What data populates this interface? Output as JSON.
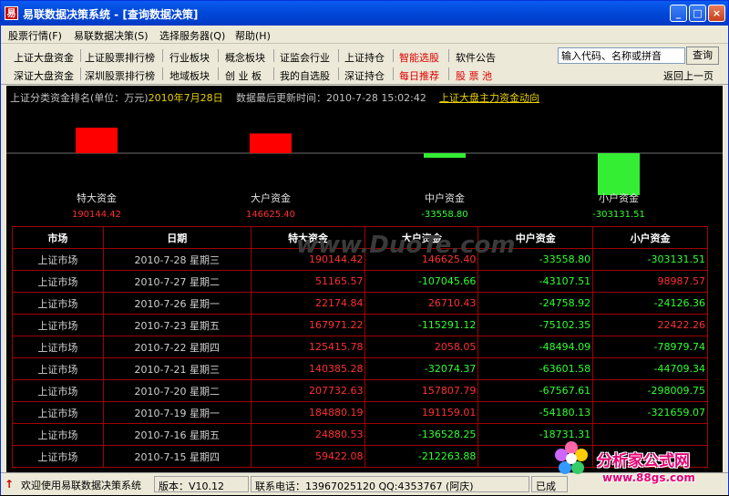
{
  "window": {
    "title": "易联数据决策系统  - [查询数据决策]",
    "minimize": "_",
    "maximize": "□",
    "close": "×"
  },
  "menu": [
    "股票行情(F)",
    "易联数据决策(S)",
    "选择服务器(Q)",
    "帮助(H)"
  ],
  "toolbar": {
    "row1": [
      "上证大盘资金",
      "上证股票排行榜",
      "行业板块",
      "概念板块",
      "证监会行业",
      "上证持仓",
      "智能选股",
      "软件公告"
    ],
    "row2": [
      "深证大盘资金",
      "深圳股票排行榜",
      "地域板块",
      "创 业 板",
      "我的自选股",
      "深证持仓",
      "每日推荐",
      "股 票 池"
    ],
    "search_placeholder": "输入代码、名称或拼音",
    "search_button": "查询",
    "back": "返回上一页"
  },
  "info": {
    "label": "上证分类资金排名(单位：万元)",
    "date": "2010年7月28日",
    "update_label": "数据最后更新时间：2010-7-28 15:02:42",
    "link": "上证大盘主力资金动向"
  },
  "chart_data": {
    "type": "bar",
    "categories": [
      "特大资金",
      "大户资金",
      "中户资金",
      "小户资金"
    ],
    "values": [
      190144.42,
      146625.4,
      -33558.8,
      -303131.51
    ],
    "value_labels": [
      "190144.42",
      "146625.40",
      "-33558.80",
      "-303131.51"
    ],
    "colors": {
      "positive": "#ff0000",
      "negative": "#33ee33"
    }
  },
  "table": {
    "headers": [
      "市场",
      "日期",
      "特大资金",
      "大户资金",
      "中户资金",
      "小户资金"
    ],
    "rows": [
      [
        "上证市场",
        "2010-7-28 星期三",
        "190144.42",
        "146625.40",
        "-33558.80",
        "-303131.51"
      ],
      [
        "上证市场",
        "2010-7-27 星期二",
        "51165.57",
        "-107045.66",
        "-43107.51",
        "98987.57"
      ],
      [
        "上证市场",
        "2010-7-26 星期一",
        "22174.84",
        "26710.43",
        "-24758.92",
        "-24126.36"
      ],
      [
        "上证市场",
        "2010-7-23 星期五",
        "167971.22",
        "-115291.12",
        "-75102.35",
        "22422.26"
      ],
      [
        "上证市场",
        "2010-7-22 星期四",
        "125415.78",
        "2058.05",
        "-48494.09",
        "-78979.74"
      ],
      [
        "上证市场",
        "2010-7-21 星期三",
        "140385.28",
        "-32074.37",
        "-63601.58",
        "-44709.34"
      ],
      [
        "上证市场",
        "2010-7-20 星期二",
        "207732.63",
        "157807.79",
        "-67567.61",
        "-298009.75"
      ],
      [
        "上证市场",
        "2010-7-19 星期一",
        "184880.19",
        "191159.01",
        "-54180.13",
        "-321659.07"
      ],
      [
        "上证市场",
        "2010-7-16 星期五",
        "24880.53",
        "-136528.25",
        "-18731.31",
        ""
      ],
      [
        "上证市场",
        "2010-7-15 星期四",
        "59422.08",
        "-212263.88",
        "",
        ""
      ]
    ]
  },
  "watermark": "www.DuoTe.com",
  "status": {
    "welcome": "欢迎使用易联数据决策系统",
    "version": "版本：V10.12",
    "contact": "联系电话：13967025120 QQ:4353767 (阿庆)",
    "extra": "已成"
  },
  "logo": {
    "line1": "分析家公式网",
    "line2": "www.88gs.com"
  }
}
